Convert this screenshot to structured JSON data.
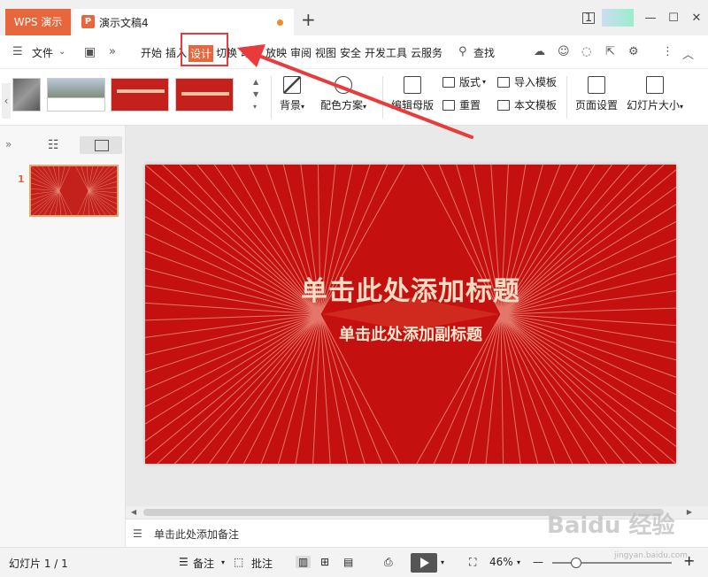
{
  "titlebar": {
    "app_tab": "WPS 演示",
    "doc_title": "演示文稿4",
    "doc_icon_glyph": "P",
    "page_badge": "1"
  },
  "menubar": {
    "file_label": "文件",
    "tabs": [
      "开始",
      "插入",
      "设计",
      "切换",
      "动画",
      "放映",
      "审阅",
      "视图",
      "安全",
      "开发工具",
      "云服务"
    ],
    "active_tab": "设计",
    "search_label": "查找"
  },
  "ribbon": {
    "background_label": "背景",
    "color_scheme_label": "配色方案",
    "edit_master_label": "编辑母版",
    "layout_label": "版式",
    "reset_label": "重置",
    "import_template_label": "导入模板",
    "text_template_label": "本文模板",
    "page_setup_label": "页面设置",
    "slide_size_label": "幻灯片大小"
  },
  "panel": {
    "slide_number": "1"
  },
  "slide": {
    "title": "单击此处添加标题",
    "subtitle": "单击此处添加副标题"
  },
  "notes": {
    "placeholder": "单击此处添加备注"
  },
  "statusbar": {
    "slide_info": "幻灯片 1 / 1",
    "notes_label": "备注",
    "comment_label": "批注",
    "zoom": "46%",
    "zoom_fraction": 0.2
  },
  "watermark": {
    "text": "Baidu 经验",
    "subtext": "jingyan.baidu.com"
  },
  "colors": {
    "accent": "#e8663c",
    "slide_bg": "#c4100f",
    "highlight": "#e83c3c"
  }
}
